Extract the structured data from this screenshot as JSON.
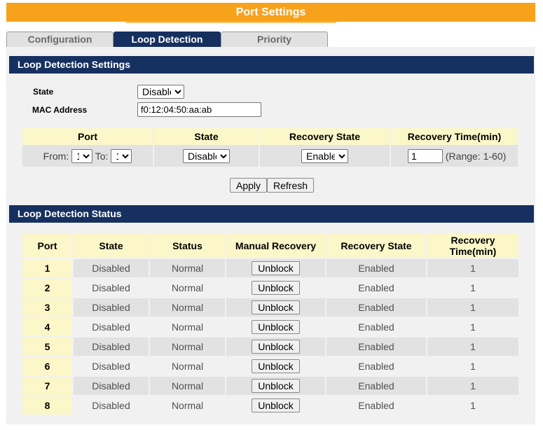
{
  "page_title": "Port Settings",
  "tabs": [
    {
      "label": "Configuration",
      "active": false
    },
    {
      "label": "Loop Detection",
      "active": true
    },
    {
      "label": "Priority",
      "active": false
    }
  ],
  "settings": {
    "header": "Loop Detection Settings",
    "state_label": "State",
    "state_value": "Disable",
    "mac_label": "MAC Address",
    "mac_value": "f0:12:04:50:aa:ab"
  },
  "port_config": {
    "headers": [
      "Port",
      "State",
      "Recovery State",
      "Recovery Time(min)"
    ],
    "from_label": "From:",
    "from_value": "1",
    "to_label": "To:",
    "to_value": "1",
    "state_value": "Disable",
    "recovery_state_value": "Enable",
    "recovery_time_value": "1",
    "range_text": "(Range: 1-60)"
  },
  "buttons": {
    "apply": "Apply",
    "refresh": "Refresh"
  },
  "status": {
    "header": "Loop Detection Status",
    "columns": [
      "Port",
      "State",
      "Status",
      "Manual Recovery",
      "Recovery State",
      "Recovery Time(min)"
    ],
    "unblock_label": "Unblock",
    "rows": [
      {
        "port": "1",
        "state": "Disabled",
        "status": "Normal",
        "recovery_state": "Enabled",
        "recovery_time": "1"
      },
      {
        "port": "2",
        "state": "Disabled",
        "status": "Normal",
        "recovery_state": "Enabled",
        "recovery_time": "1"
      },
      {
        "port": "3",
        "state": "Disabled",
        "status": "Normal",
        "recovery_state": "Enabled",
        "recovery_time": "1"
      },
      {
        "port": "4",
        "state": "Disabled",
        "status": "Normal",
        "recovery_state": "Enabled",
        "recovery_time": "1"
      },
      {
        "port": "5",
        "state": "Disabled",
        "status": "Normal",
        "recovery_state": "Enabled",
        "recovery_time": "1"
      },
      {
        "port": "6",
        "state": "Disabled",
        "status": "Normal",
        "recovery_state": "Enabled",
        "recovery_time": "1"
      },
      {
        "port": "7",
        "state": "Disabled",
        "status": "Normal",
        "recovery_state": "Enabled",
        "recovery_time": "1"
      },
      {
        "port": "8",
        "state": "Disabled",
        "status": "Normal",
        "recovery_state": "Enabled",
        "recovery_time": "1"
      }
    ]
  },
  "colors": {
    "title_bar": "#f7a21b",
    "section_bar": "#163060",
    "header_cell": "#fcf7c9"
  }
}
